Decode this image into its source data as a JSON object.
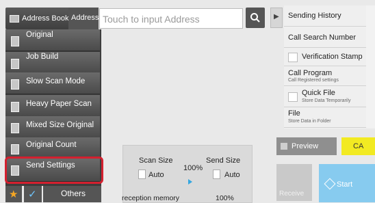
{
  "topbar": {
    "address_book_label": "Address Book",
    "address_label": "Address",
    "address_placeholder": "Touch to input Address",
    "search_icon": "search-icon"
  },
  "left_menu": {
    "items": [
      {
        "label": "Original"
      },
      {
        "label": "Job Build"
      },
      {
        "label": "Slow Scan Mode"
      },
      {
        "label": "Heavy Paper Scan"
      },
      {
        "label": "Mixed Size Original"
      },
      {
        "label": "Original Count"
      },
      {
        "label": "Send Settings"
      }
    ],
    "others_label": "Others"
  },
  "right_panel": {
    "items": [
      {
        "label": "Sending History"
      },
      {
        "label": "Call Search Number"
      },
      {
        "label": "Verification Stamp"
      },
      {
        "label": "Call Program",
        "sub": "Call Registered settings"
      },
      {
        "label": "Quick File",
        "sub": "Store Data Temporarily"
      },
      {
        "label": "File",
        "sub": "Store Data in Folder"
      }
    ]
  },
  "status": {
    "scan_size_label": "Scan Size",
    "send_size_label": "Send Size",
    "ratio": "100%",
    "scan_size_value": "Auto",
    "send_size_value": "Auto",
    "memory_label": "reception memory",
    "memory_value": "100%"
  },
  "actions": {
    "preview_label": "Preview",
    "ca_label": "CA",
    "receive_label": "Receive",
    "start_label": "Start"
  },
  "colors": {
    "highlight": "#d4202f",
    "ca": "#f2ea22",
    "start": "#87cbef"
  }
}
